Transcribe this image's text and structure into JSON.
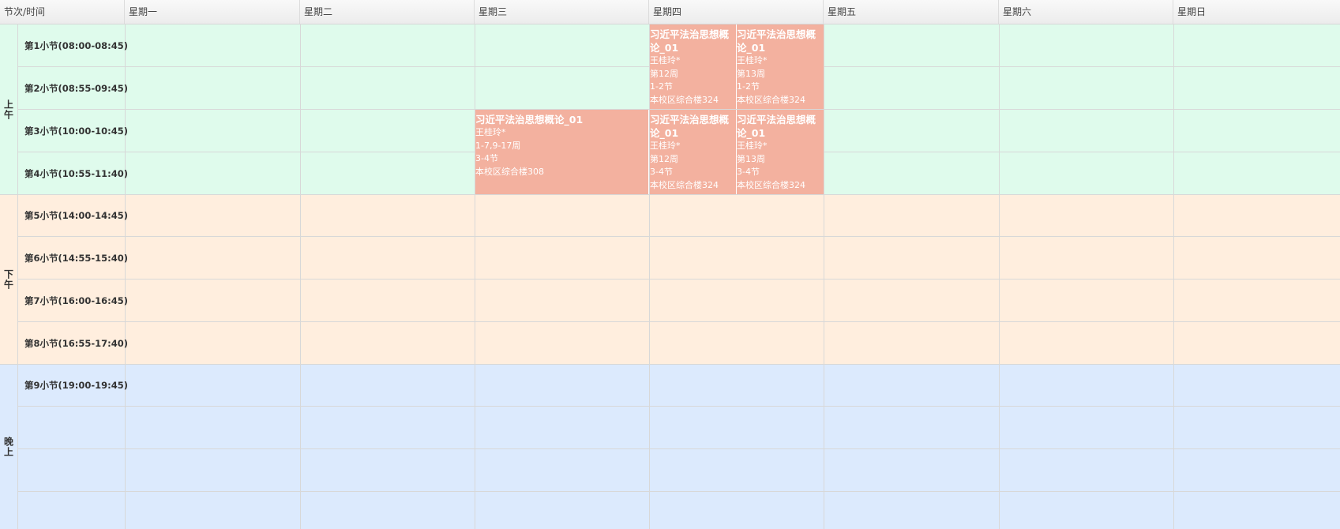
{
  "header": {
    "corner": "节次/时间",
    "days": [
      "星期一",
      "星期二",
      "星期三",
      "星期四",
      "星期五",
      "星期六",
      "星期日"
    ]
  },
  "sessions": {
    "morning": "上午",
    "afternoon": "下午",
    "evening": "晚上"
  },
  "periods": [
    "第1小节(08:00-08:45)",
    "第2小节(08:55-09:45)",
    "第3小节(10:00-10:45)",
    "第4小节(10:55-11:40)",
    "第5小节(14:00-14:45)",
    "第6小节(14:55-15:40)",
    "第7小节(16:00-16:45)",
    "第8小节(16:55-17:40)",
    "第9小节(19:00-19:45)"
  ],
  "courses": [
    {
      "title": "习近平法治思想概论_01",
      "teacher": "王桂玲*",
      "weeks": "1-7,9-17周",
      "periods": "3-4节",
      "room": "本校区综合楼308"
    },
    {
      "title": "习近平法治思想概论_01",
      "teacher": "王桂玲*",
      "weeks": "第12周",
      "periods": "1-2节",
      "room": "本校区综合楼324"
    },
    {
      "title": "习近平法治思想概论_01",
      "teacher": "王桂玲*",
      "weeks": "第13周",
      "periods": "1-2节",
      "room": "本校区综合楼324"
    },
    {
      "title": "习近平法治思想概论_01",
      "teacher": "王桂玲*",
      "weeks": "第12周",
      "periods": "3-4节",
      "room": "本校区综合楼324"
    },
    {
      "title": "习近平法治思想概论_01",
      "teacher": "王桂玲*",
      "weeks": "第13周",
      "periods": "3-4节",
      "room": "本校区综合楼324"
    }
  ],
  "colors": {
    "morning": "#dffbec",
    "afternoon": "#ffeede",
    "evening": "#dceafd",
    "course": "#f3b19f"
  }
}
